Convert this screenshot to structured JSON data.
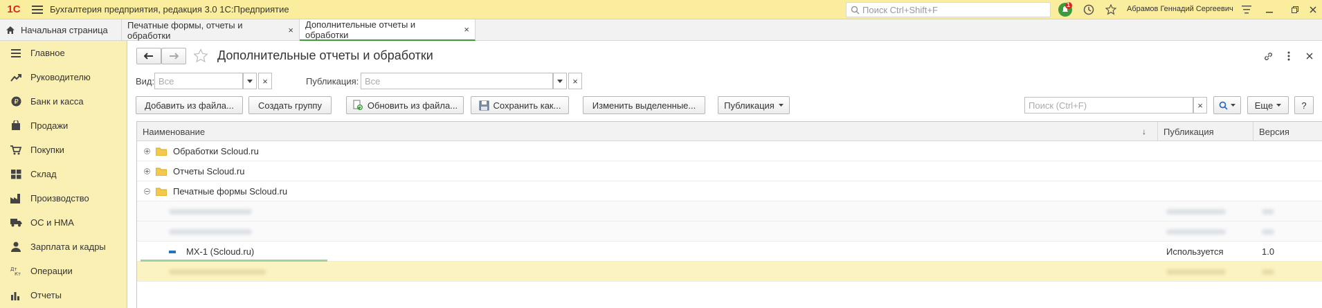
{
  "topbar": {
    "logo": "1С",
    "title": "Бухгалтерия предприятия, редакция 3.0 1С:Предприятие",
    "search_placeholder": "Поиск Ctrl+Shift+F",
    "notification_count": "1",
    "user_name": "Абрамов Геннадий Сергеевич"
  },
  "tabs": [
    {
      "label": "Начальная страница"
    },
    {
      "label": "Печатные формы, отчеты и обработки",
      "close": "×"
    },
    {
      "label": "Дополнительные отчеты и обработки",
      "close": "×"
    }
  ],
  "sidebar": {
    "items": [
      {
        "label": "Главное",
        "icon": "menu-lines-icon"
      },
      {
        "label": "Руководителю",
        "icon": "trend-icon"
      },
      {
        "label": "Банк и касса",
        "icon": "ruble-coin-icon"
      },
      {
        "label": "Продажи",
        "icon": "bag-icon"
      },
      {
        "label": "Покупки",
        "icon": "cart-icon"
      },
      {
        "label": "Склад",
        "icon": "warehouse-icon"
      },
      {
        "label": "Производство",
        "icon": "factory-icon"
      },
      {
        "label": "ОС и НМА",
        "icon": "truck-icon"
      },
      {
        "label": "Зарплата и кадры",
        "icon": "person-icon"
      },
      {
        "label": "Операции",
        "icon": "dt-kt-icon"
      },
      {
        "label": "Отчеты",
        "icon": "bar-chart-icon"
      }
    ]
  },
  "form": {
    "title": "Дополнительные отчеты и обработки",
    "vid_label": "Вид:",
    "vid_placeholder": "Все",
    "pub_label": "Публикация:",
    "pub_placeholder": "Все",
    "clear": "×",
    "buttons": {
      "add_from_file": "Добавить из файла...",
      "create_group": "Создать группу",
      "update_from_file": "Обновить из файла...",
      "save_as": "Сохранить как...",
      "change_selected": "Изменить выделенные...",
      "publication": "Публикация",
      "more": "Еще",
      "help": "?"
    },
    "search_placeholder": "Поиск (Ctrl+F)"
  },
  "grid": {
    "columns": {
      "name": "Наименование",
      "publication": "Публикация",
      "version": "Версия"
    },
    "sort_indicator": "↓",
    "groups": [
      {
        "name": "Обработки Scloud.ru",
        "state": "collapsed"
      },
      {
        "name": "Отчеты Scloud.ru",
        "state": "collapsed"
      },
      {
        "name": "Печатные формы Scloud.ru",
        "state": "expanded"
      }
    ],
    "item": {
      "name": "МХ-1 (Scloud.ru)",
      "publication": "Используется",
      "version": "1.0"
    }
  }
}
